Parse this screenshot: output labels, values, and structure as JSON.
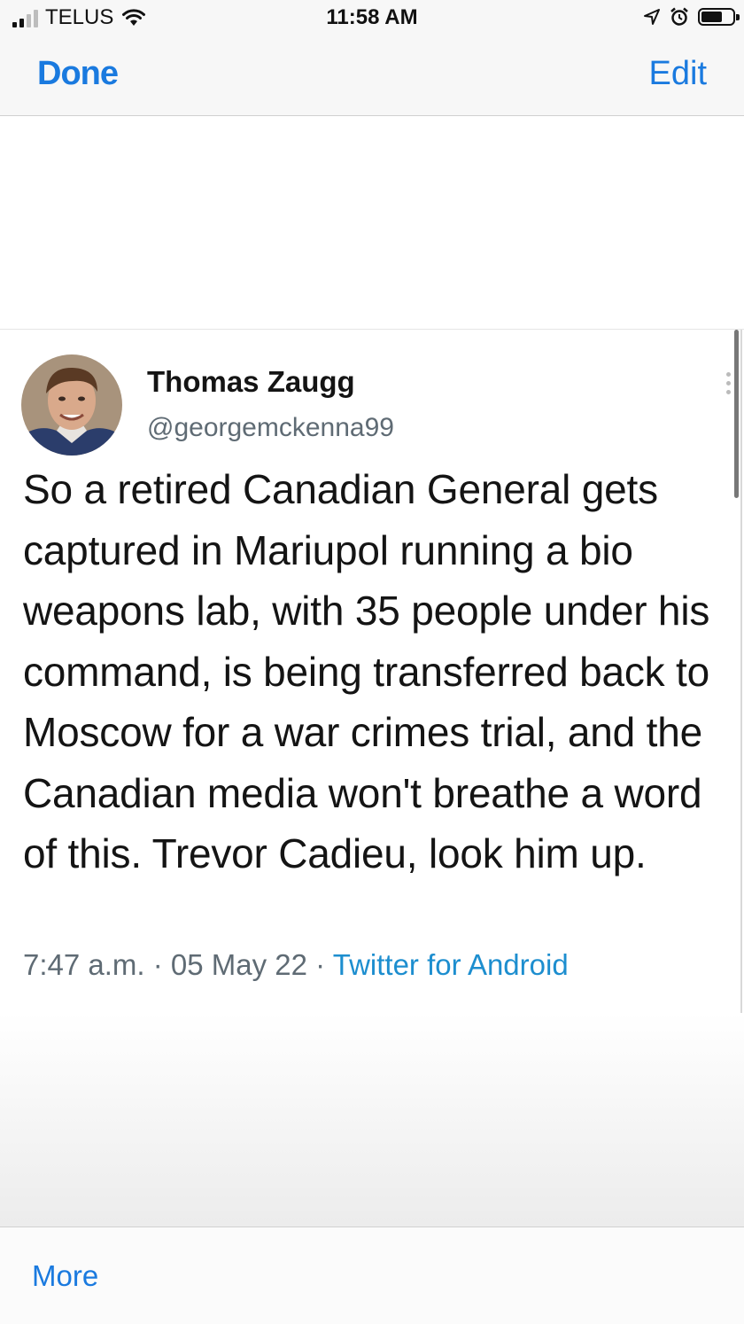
{
  "status_bar": {
    "carrier": "TELUS",
    "time": "11:58 AM"
  },
  "nav": {
    "done_label": "Done",
    "edit_label": "Edit"
  },
  "tweet": {
    "author_name": "Thomas Zaugg",
    "author_handle": "@georgemckenna99",
    "text": "So a retired Canadian General gets captured in Mariupol running a bio weapons lab, with 35 people under his command, is being transferred back to Moscow for a war crimes trial, and the Canadian media won't breathe a word of this. Trevor Cadieu, look him up.",
    "time": "7:47 a.m.",
    "date": "05 May 22",
    "source": "Twitter for Android",
    "separator": " · "
  },
  "toolbar": {
    "more_label": "More"
  },
  "colors": {
    "accent": "#1a7adf",
    "source_link": "#1d8ecf",
    "secondary_text": "#5f6b74"
  },
  "icons": [
    "cellular-signal-icon",
    "wifi-icon",
    "location-arrow-icon",
    "alarm-clock-icon",
    "battery-icon",
    "more-dots-icon"
  ]
}
